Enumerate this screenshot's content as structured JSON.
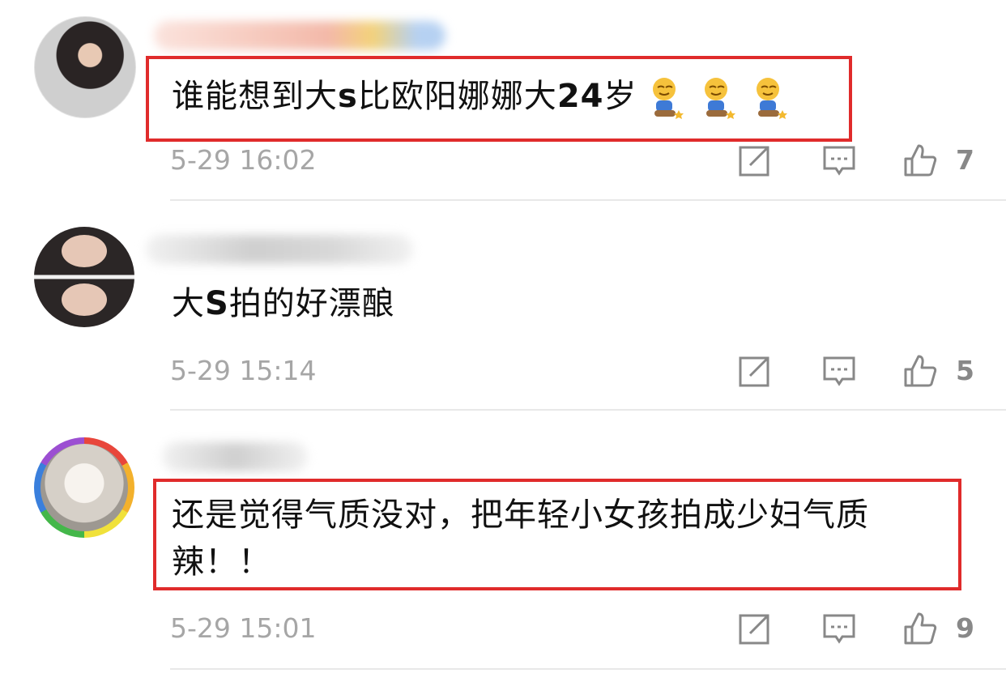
{
  "comments": [
    {
      "text_pre": "谁能想到大",
      "text_b1": "s",
      "text_mid": "比欧阳娜娜大",
      "text_b2": "24",
      "text_post": "岁",
      "emoji_name": "kneeling-emoji-icon",
      "emoji_count": 3,
      "time": "5-29 16:02",
      "likes": "7",
      "highlighted": true
    },
    {
      "text_pre": "大",
      "text_b1": "S",
      "text_post": "拍的好漂酿",
      "time": "5-29 15:14",
      "likes": "5",
      "highlighted": false
    },
    {
      "line1": "还是觉得气质没对，把年轻小女孩拍成少妇气质",
      "line2": "辣！！",
      "time": "5-29 15:01",
      "likes": "9",
      "highlighted": true
    }
  ],
  "icons": {
    "share": "share-icon",
    "comment": "comment-icon",
    "like": "thumbs-up-icon"
  },
  "colors": {
    "highlight_border": "#e02b2b",
    "timestamp": "#a6a6a6"
  }
}
